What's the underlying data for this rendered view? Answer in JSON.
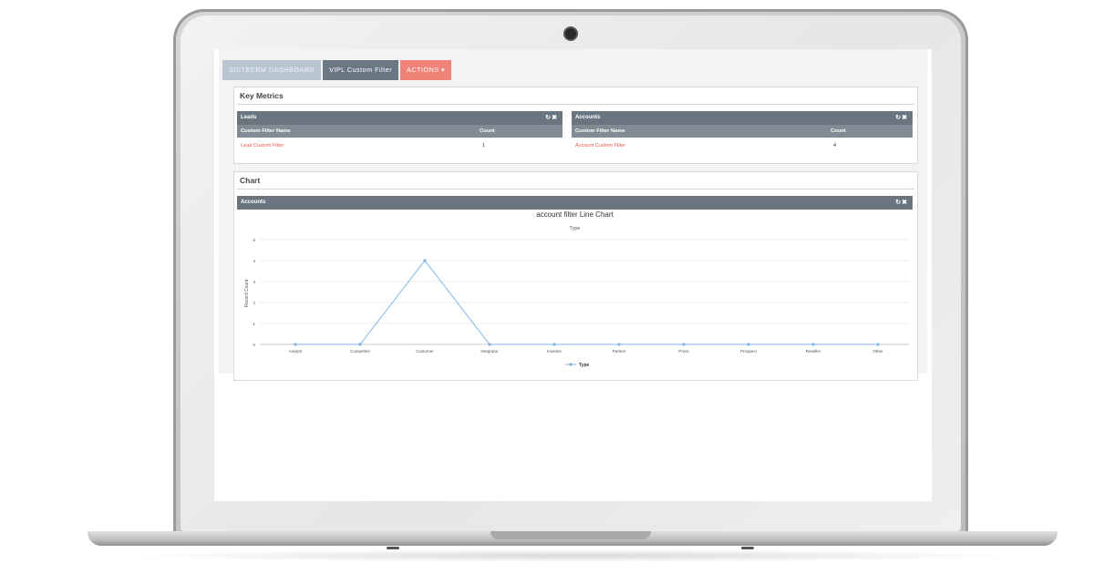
{
  "tabs": {
    "dashboard": "SUITECRM DASHBOARD",
    "custom_filter": "VIPL Custom Filter",
    "actions": "ACTIONS ▾"
  },
  "key_metrics": {
    "title": "Key Metrics",
    "leads": {
      "title": "Leads",
      "col_name": "Custom Filter Name",
      "col_count": "Count",
      "row_name": "Lead Custom Filter",
      "row_count": "1"
    },
    "accounts": {
      "title": "Accounts",
      "col_name": "Custom Filter Name",
      "col_count": "Count",
      "row_name": "Account Custom Filter",
      "row_count": "4"
    }
  },
  "chart_panel": {
    "title": "Chart",
    "dashlet_title": "Accounts"
  },
  "colors": {
    "line": "#7fb6e6",
    "header": "#6a7580",
    "link": "#e8574a",
    "actions_tab": "#f08377"
  },
  "chart_data": {
    "type": "line",
    "title": "account filter Line Chart",
    "subtitle": "Type",
    "xlabel": "",
    "ylabel": "Record Count",
    "categories": [
      "Analyst",
      "Competitor",
      "Customer",
      "Integrator",
      "Investor",
      "Partner",
      "Press",
      "Prospect",
      "Reseller",
      "Other"
    ],
    "series": [
      {
        "name": "Type",
        "values": [
          0,
          0,
          4,
          0,
          0,
          0,
          0,
          0,
          0,
          0
        ]
      }
    ],
    "yticks": [
      "0",
      "1",
      "2",
      "3",
      "4",
      "5"
    ],
    "ylim": [
      0,
      5
    ],
    "grid": true,
    "legend": "bottom-center"
  }
}
